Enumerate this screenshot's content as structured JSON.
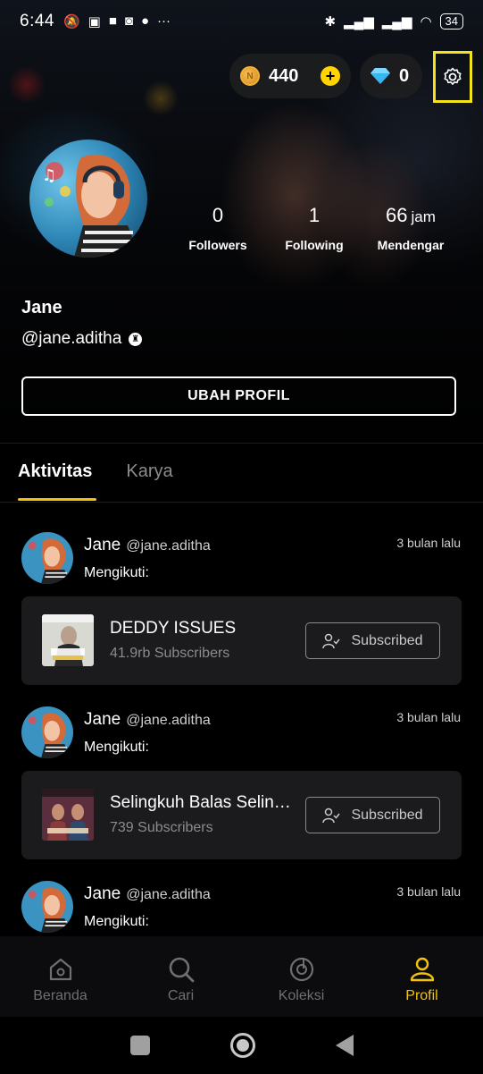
{
  "status_bar": {
    "time": "6:44",
    "battery": "34"
  },
  "wallet": {
    "coins": "440",
    "gems": "0"
  },
  "profile": {
    "name": "Jane",
    "handle": "@jane.aditha",
    "stats": [
      {
        "value": "0",
        "unit": "",
        "label": "Followers"
      },
      {
        "value": "1",
        "unit": "",
        "label": "Following"
      },
      {
        "value": "66",
        "unit": "jam",
        "label": "Mendengar"
      }
    ],
    "edit_button": "UBAH PROFIL"
  },
  "tabs": [
    {
      "label": "Aktivitas",
      "active": true
    },
    {
      "label": "Karya",
      "active": false
    }
  ],
  "activities": [
    {
      "name": "Jane",
      "handle": "@jane.aditha",
      "time": "3 bulan lalu",
      "action": "Mengikuti:",
      "card": {
        "title": "DEDDY ISSUES",
        "subscribers": "41.9rb Subscribers",
        "button": "Subscribed"
      }
    },
    {
      "name": "Jane",
      "handle": "@jane.aditha",
      "time": "3 bulan lalu",
      "action": "Mengikuti:",
      "card": {
        "title": "Selingkuh Balas Selingkuh",
        "subscribers": "739 Subscribers",
        "button": "Subscribed"
      }
    },
    {
      "name": "Jane",
      "handle": "@jane.aditha",
      "time": "3 bulan lalu",
      "action": "Mengikuti:"
    }
  ],
  "bottom_nav": [
    {
      "label": "Beranda",
      "icon": "home-icon"
    },
    {
      "label": "Cari",
      "icon": "search-icon"
    },
    {
      "label": "Koleksi",
      "icon": "collection-icon"
    },
    {
      "label": "Profil",
      "icon": "profile-icon",
      "active": true
    }
  ],
  "colors": {
    "accent": "#f4c20d",
    "highlight_box": "#f4e21a",
    "card_bg": "#1b1b1d"
  }
}
